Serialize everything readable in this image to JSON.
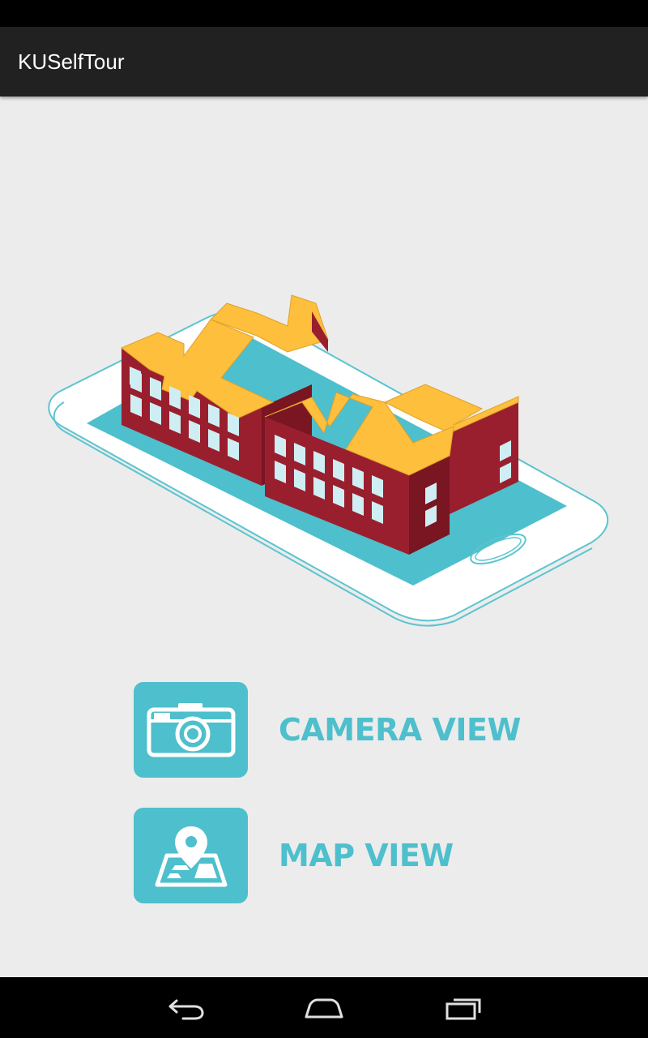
{
  "app": {
    "title": "KUSelfTour"
  },
  "logo": {
    "description_icon": "ku-buildings-on-phone-logo"
  },
  "menu": {
    "camera": {
      "label": "CAMERA VIEW",
      "icon": "camera-icon"
    },
    "map": {
      "label": "MAP VIEW",
      "icon": "map-pin-icon"
    }
  },
  "nav": {
    "back_icon": "back-icon",
    "home_icon": "home-icon",
    "recents_icon": "recents-icon"
  },
  "colors": {
    "accent": "#4ebfcc",
    "building_red": "#9a1f2e",
    "building_yellow": "#fdbf3c",
    "window_light": "#cfeef3",
    "action_bar": "#212121",
    "background": "#ececec"
  }
}
